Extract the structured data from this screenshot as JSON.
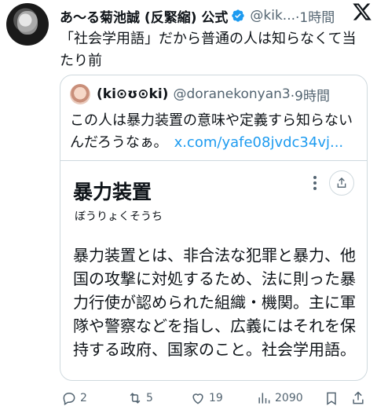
{
  "author": {
    "name": "あ〜る菊池誠 (反緊縮) 公式",
    "handle": "@kik...",
    "time": "·1時間"
  },
  "tweet": {
    "text": "「社会学用語」だから普通の人は知らなくて当たり前"
  },
  "quote": {
    "name": "(ki⊙ʊ⊙ki)",
    "handle": "@doranekonyan3",
    "time": "·9時間",
    "text": "この人は暴力装置の意味や定義すら知らないんだろうなぁ。",
    "link": "x.com/yafe08jvdc34vj..."
  },
  "card": {
    "title": "暴力装置",
    "reading": "ぼうりょくそうち",
    "body": "暴力装置とは、非合法な犯罪と暴力、他国の攻撃に対処するため、法に則った暴力行使が認められた組織・機関。主に軍隊や警察などを指し、広義にはそれを保持する政府、国家のこと。社会学用語。"
  },
  "actions": {
    "replies": "2",
    "reposts": "5",
    "likes": "19",
    "views": "2090"
  },
  "colors": {
    "text": "#0f1419",
    "secondary": "#536471",
    "link": "#1d9bf0",
    "verified": "#1d9bf0",
    "border": "#cfd9de"
  }
}
